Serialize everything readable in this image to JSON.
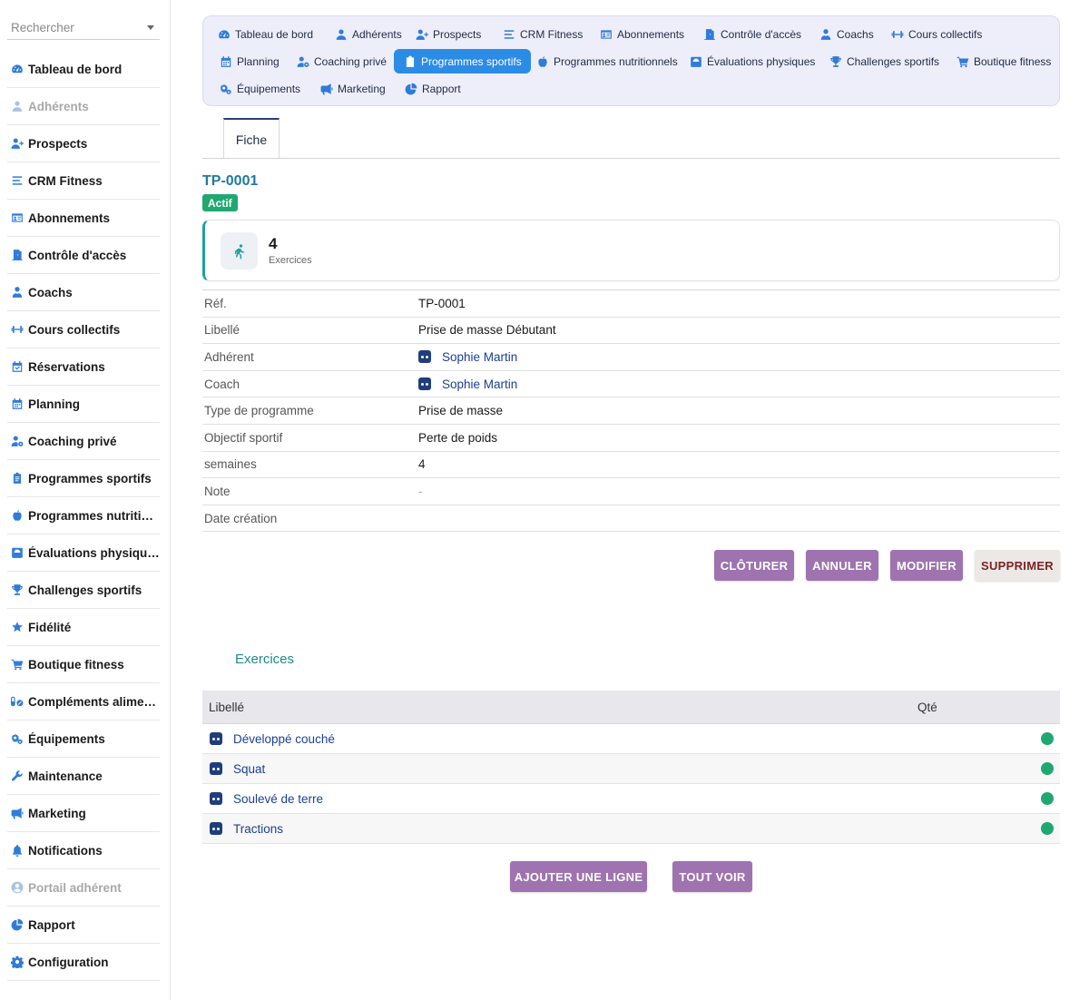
{
  "search": {
    "placeholder": "Rechercher"
  },
  "sidebar": {
    "items": [
      {
        "label": "Tableau de bord",
        "icon": "dashboard-icon",
        "disabled": false
      },
      {
        "label": "Adhérents",
        "icon": "user-icon",
        "disabled": true
      },
      {
        "label": "Prospects",
        "icon": "user-plus-icon",
        "disabled": false
      },
      {
        "label": "CRM Fitness",
        "icon": "list-icon",
        "disabled": false
      },
      {
        "label": "Abonnements",
        "icon": "id-card-icon",
        "disabled": false
      },
      {
        "label": "Contrôle d'accès",
        "icon": "door-icon",
        "disabled": false
      },
      {
        "label": "Coachs",
        "icon": "user-tie-icon",
        "disabled": false
      },
      {
        "label": "Cours collectifs",
        "icon": "dumbbell-icon",
        "disabled": false
      },
      {
        "label": "Réservations",
        "icon": "calendar-check-icon",
        "disabled": false
      },
      {
        "label": "Planning",
        "icon": "calendar-icon",
        "disabled": false
      },
      {
        "label": "Coaching privé",
        "icon": "user-cog-icon",
        "disabled": false
      },
      {
        "label": "Programmes sportifs",
        "icon": "clipboard-icon",
        "disabled": false
      },
      {
        "label": "Programmes nutritionnels",
        "icon": "apple-icon",
        "disabled": false
      },
      {
        "label": "Évaluations physiques",
        "icon": "weight-scale-icon",
        "disabled": false
      },
      {
        "label": "Challenges sportifs",
        "icon": "trophy-icon",
        "disabled": false
      },
      {
        "label": "Fidélité",
        "icon": "star-icon",
        "disabled": false
      },
      {
        "label": "Boutique fitness",
        "icon": "cart-icon",
        "disabled": false
      },
      {
        "label": "Compléments alimentaires",
        "icon": "pills-icon",
        "disabled": false
      },
      {
        "label": "Équipements",
        "icon": "gears-icon",
        "disabled": false
      },
      {
        "label": "Maintenance",
        "icon": "wrench-icon",
        "disabled": false
      },
      {
        "label": "Marketing",
        "icon": "megaphone-icon",
        "disabled": false
      },
      {
        "label": "Notifications",
        "icon": "bell-icon",
        "disabled": false
      },
      {
        "label": "Portail adhérent",
        "icon": "user-circle-icon",
        "disabled": true
      },
      {
        "label": "Rapport",
        "icon": "pie-chart-icon",
        "disabled": false
      },
      {
        "label": "Configuration",
        "icon": "gear-icon",
        "disabled": false
      }
    ]
  },
  "topnav": {
    "tabs": [
      {
        "label": "Tableau de bord",
        "icon": "dashboard-icon"
      },
      {
        "label": "Adhérents",
        "icon": "user-icon"
      },
      {
        "label": "Prospects",
        "icon": "user-plus-icon"
      },
      {
        "label": "CRM Fitness",
        "icon": "list-icon"
      },
      {
        "label": "Abonnements",
        "icon": "id-card-icon"
      },
      {
        "label": "Contrôle d'accès",
        "icon": "door-icon"
      },
      {
        "label": "Coachs",
        "icon": "user-tie-icon"
      },
      {
        "label": "Cours collectifs",
        "icon": "dumbbell-icon"
      },
      {
        "label": "Planning",
        "icon": "calendar-icon"
      },
      {
        "label": "Coaching privé",
        "icon": "user-cog-icon"
      },
      {
        "label": "Programmes sportifs",
        "icon": "clipboard-icon",
        "active": true
      },
      {
        "label": "Programmes nutritionnels",
        "icon": "apple-icon"
      },
      {
        "label": "Évaluations physiques",
        "icon": "weight-scale-icon"
      },
      {
        "label": "Challenges sportifs",
        "icon": "trophy-icon"
      },
      {
        "label": "Boutique fitness",
        "icon": "cart-icon"
      },
      {
        "label": "Équipements",
        "icon": "gears-icon"
      },
      {
        "label": "Marketing",
        "icon": "megaphone-icon"
      },
      {
        "label": "Rapport",
        "icon": "pie-chart-icon"
      }
    ]
  },
  "record": {
    "tab_label": "Fiche",
    "ref": "TP-0001",
    "status": "Actif",
    "stat": {
      "value": "4",
      "label": "Exercices",
      "icon": "running-icon"
    },
    "fields": [
      {
        "label": "Réf.",
        "value": "TP-0001"
      },
      {
        "label": "Libellé",
        "value": "Prise de masse Débutant"
      },
      {
        "label": "Adhérent",
        "value": "Sophie Martin",
        "link": true
      },
      {
        "label": "Coach",
        "value": "Sophie Martin",
        "link": true
      },
      {
        "label": "Type de programme",
        "value": "Prise de masse"
      },
      {
        "label": "Objectif sportif",
        "value": "Perte de poids"
      },
      {
        "label": "semaines",
        "value": "4"
      },
      {
        "label": "Note",
        "value": "-",
        "muted": true
      },
      {
        "label": "Date création",
        "value": ""
      }
    ]
  },
  "actions": {
    "close": "CLÔTURER",
    "cancel": "ANNULER",
    "edit": "MODIFIER",
    "delete": "SUPPRIMER"
  },
  "lines": {
    "title": "Exercices",
    "columns": {
      "label": "Libellé",
      "qty": "Qté"
    },
    "rows": [
      {
        "label": "Développé couché",
        "status_color": "#1fa870"
      },
      {
        "label": "Squat",
        "status_color": "#1fa870"
      },
      {
        "label": "Soulevé de terre",
        "status_color": "#1fa870"
      },
      {
        "label": "Tractions",
        "status_color": "#1fa870"
      }
    ],
    "add_label": "AJOUTER UNE LIGNE",
    "view_all_label": "TOUT VOIR"
  },
  "colors": {
    "accent": "#2b8ce6",
    "icon_blue": "#2f7cd8",
    "button_purple": "#9e73b0",
    "status_green": "#1fa870",
    "teal": "#1aa39b"
  }
}
